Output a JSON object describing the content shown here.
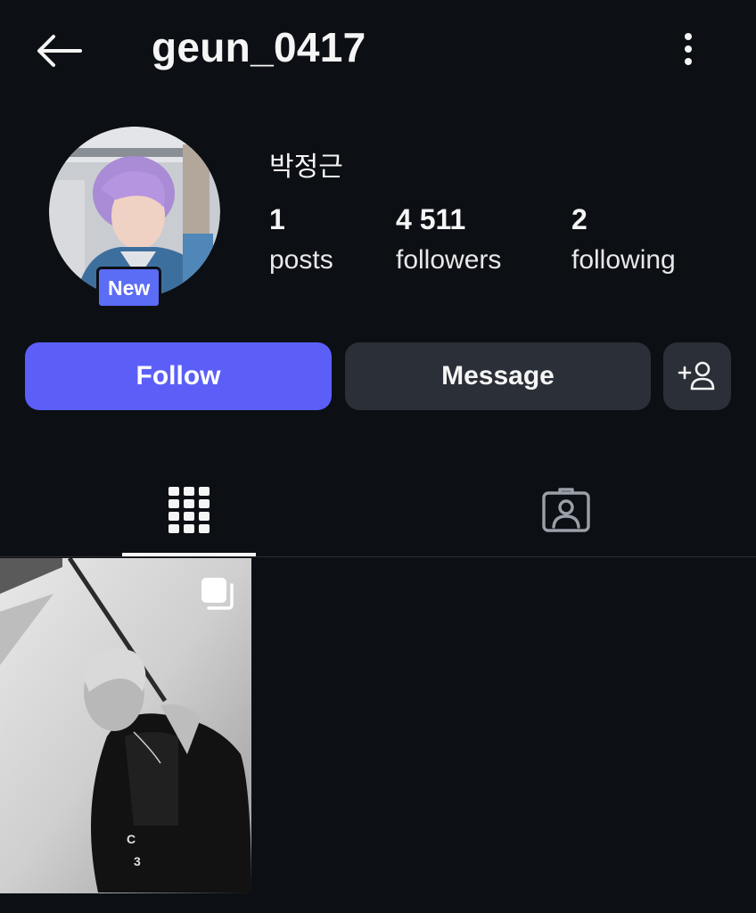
{
  "header": {
    "username": "geun_0417",
    "back_icon": "arrow-left-icon",
    "more_icon": "more-vertical-icon"
  },
  "profile": {
    "display_name": "박정근",
    "new_badge": "New",
    "stats": {
      "posts": {
        "count": "1",
        "label": "posts"
      },
      "followers": {
        "count": "4 511",
        "label": "followers"
      },
      "following": {
        "count": "2",
        "label": "following"
      }
    }
  },
  "actions": {
    "follow_label": "Follow",
    "message_label": "Message",
    "add_user_icon": "add-user-icon"
  },
  "tabs": [
    {
      "icon": "grid-icon",
      "selected": true
    },
    {
      "icon": "tagged-icon",
      "selected": false
    }
  ],
  "posts": [
    {
      "type": "carousel",
      "indicator_icon": "multiple-images-icon"
    }
  ],
  "colors": {
    "background": "#0c0f14",
    "accent": "#5b5ff8",
    "secondary_button": "#2b2f37",
    "badge": "#5b6cf5"
  }
}
